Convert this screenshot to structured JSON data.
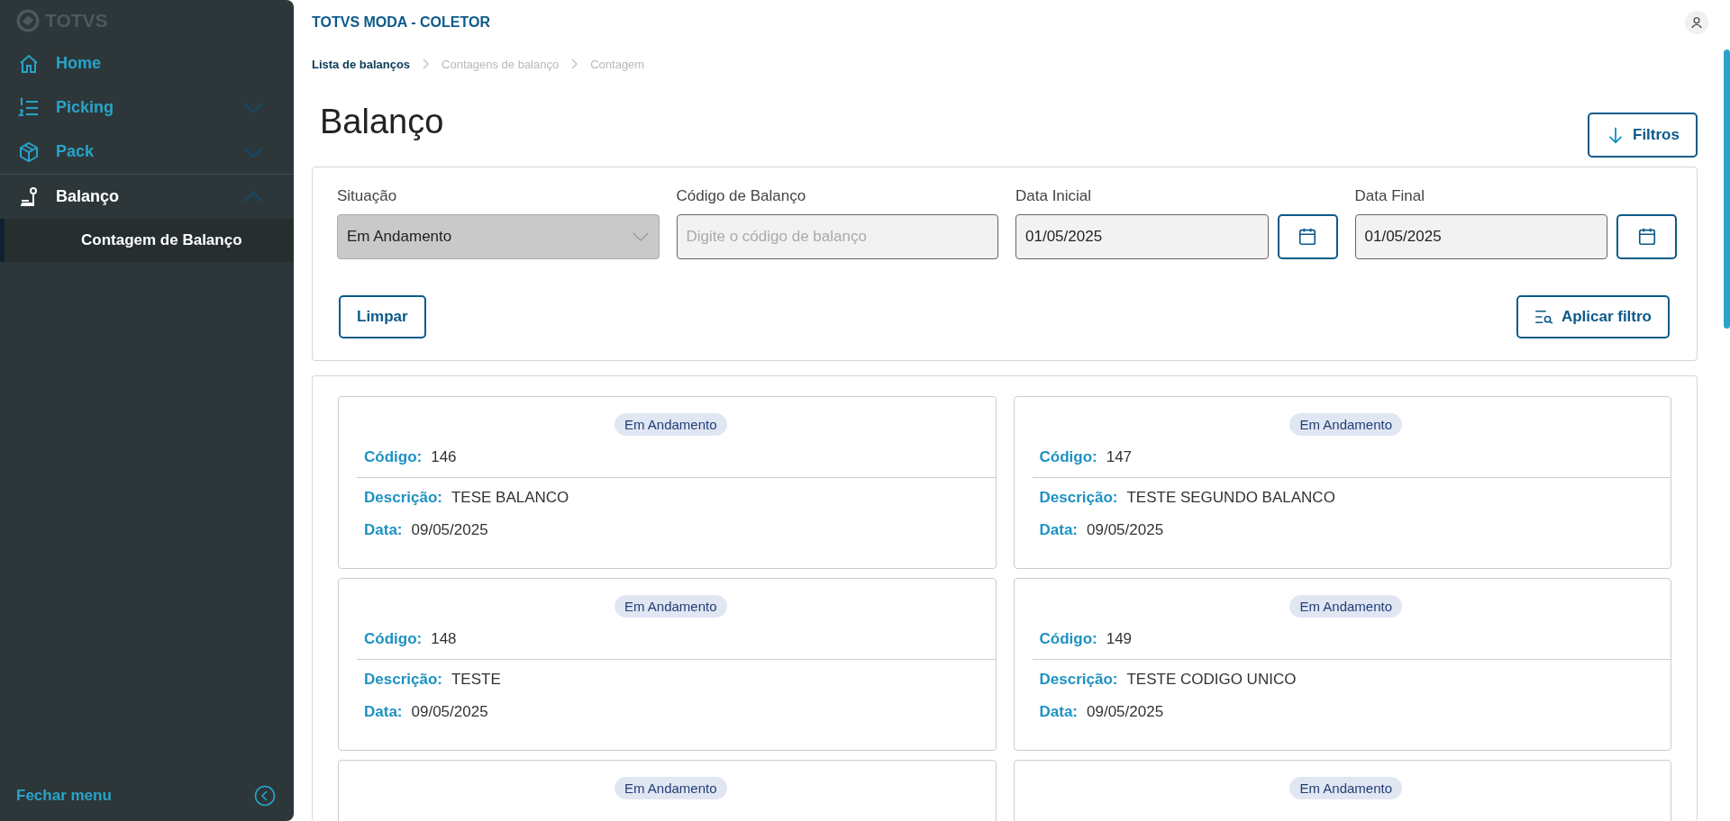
{
  "sidebar": {
    "logo": "TOTVS",
    "items": [
      {
        "label": "Home",
        "selected": false
      },
      {
        "label": "Picking",
        "selected": false,
        "expanded": false
      },
      {
        "label": "Pack",
        "selected": false,
        "expanded": false
      },
      {
        "label": "Balanço",
        "selected": true,
        "expanded": true,
        "children": [
          {
            "label": "Contagem de Balanço",
            "selected": true
          }
        ]
      }
    ],
    "footer": "Fechar menu"
  },
  "header": {
    "app_title": "TOTVS MODA - COLETOR"
  },
  "breadcrumb": [
    {
      "label": "Lista de balanços",
      "disabled": false
    },
    {
      "label": "Contagens de balanço",
      "disabled": true
    },
    {
      "label": "Contagem",
      "disabled": true
    }
  ],
  "page_title": "Balanço",
  "filters_button": "Filtros",
  "filters": {
    "fields": [
      {
        "kind": "select",
        "label": "Situação",
        "value": "Em Andamento"
      },
      {
        "kind": "text",
        "label": "Código de Balanço",
        "placeholder": "Digite o código de balanço"
      },
      {
        "kind": "date",
        "label": "Data Inicial",
        "value": "01/05/2025"
      },
      {
        "kind": "date",
        "label": "Data Final",
        "value": "01/05/2025"
      }
    ],
    "clear_button": "Limpar",
    "apply_button": "Aplicar filtro"
  },
  "cards": [
    {
      "status": "Em Andamento",
      "code_label": "Código:",
      "code": "146",
      "description_label": "Descrição:",
      "description": "TESE BALANCO",
      "date_label": "Data:",
      "date": "09/05/2025"
    },
    {
      "status": "Em Andamento",
      "code_label": "Código:",
      "code": "147",
      "description_label": "Descrição:",
      "description": "TESTE SEGUNDO BALANCO",
      "date_label": "Data:",
      "date": "09/05/2025"
    },
    {
      "status": "Em Andamento",
      "code_label": "Código:",
      "code": "148",
      "description_label": "Descrição:",
      "description": "TESTE",
      "date_label": "Data:",
      "date": "09/05/2025"
    },
    {
      "status": "Em Andamento",
      "code_label": "Código:",
      "code": "149",
      "description_label": "Descrição:",
      "description": "TESTE CODIGO UNICO",
      "date_label": "Data:",
      "date": "09/05/2025"
    },
    {
      "status": "Em Andamento"
    },
    {
      "status": "Em Andamento"
    }
  ]
}
